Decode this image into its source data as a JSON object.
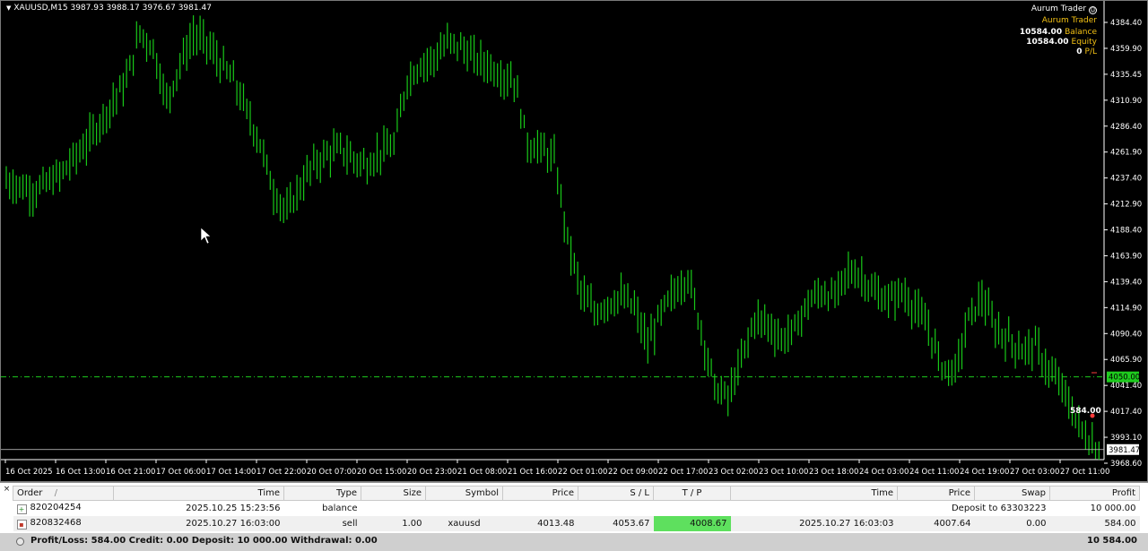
{
  "chart": {
    "symbol_header": "XAUUSD,M15  3987.93 3988.17 3976.67 3981.47",
    "ea": {
      "name": "Aurum Trader",
      "label": "Aurum Trader"
    },
    "account": {
      "balance_value": "10584.00",
      "balance_label": "Balance",
      "equity_value": "10584.00",
      "equity_label": "Equity",
      "pl_value": "0",
      "pl_label": "P/L"
    },
    "price_levels": [
      "4384.40",
      "4359.90",
      "4335.45",
      "4310.90",
      "4286.40",
      "4261.90",
      "4237.40",
      "4212.90",
      "4188.40",
      "4163.90",
      "4139.40",
      "4114.90",
      "4090.40",
      "4065.90",
      "4041.40",
      "4017.40",
      "3993.10",
      "3968.60"
    ],
    "time_labels": [
      "16 Oct 2025",
      "16 Oct 13:00",
      "16 Oct 21:00",
      "17 Oct 06:00",
      "17 Oct 14:00",
      "17 Oct 22:00",
      "20 Oct 07:00",
      "20 Oct 15:00",
      "20 Oct 23:00",
      "21 Oct 08:00",
      "21 Oct 16:00",
      "22 Oct 01:00",
      "22 Oct 09:00",
      "22 Oct 17:00",
      "23 Oct 02:00",
      "23 Oct 10:00",
      "23 Oct 18:00",
      "24 Oct 03:00",
      "24 Oct 11:00",
      "24 Oct 19:00",
      "27 Oct 03:00",
      "27 Oct 11:00"
    ],
    "level_tag": "4050.00",
    "current_price_tag": "3981.47",
    "pl_marker": "584.00",
    "colors": {
      "candles": "#18c818",
      "level_line": "#1ecb1e",
      "background": "#000000",
      "tag": "#1ecb1e",
      "text": "#ffffff"
    }
  },
  "chart_data": {
    "type": "line",
    "title": "XAUUSD,M15",
    "ylim": [
      3962,
      4396
    ],
    "x": [
      "16 Oct 2025",
      "16 Oct 13:00",
      "16 Oct 21:00",
      "17 Oct 06:00",
      "17 Oct 14:00",
      "17 Oct 22:00",
      "20 Oct 07:00",
      "20 Oct 15:00",
      "20 Oct 23:00",
      "21 Oct 08:00",
      "21 Oct 16:00",
      "22 Oct 01:00",
      "22 Oct 09:00",
      "22 Oct 17:00",
      "23 Oct 02:00",
      "23 Oct 10:00",
      "23 Oct 18:00",
      "24 Oct 03:00",
      "24 Oct 11:00",
      "24 Oct 19:00",
      "27 Oct 03:00",
      "27 Oct 11:00"
    ],
    "series": [
      {
        "values": [
          4235,
          4265,
          4375,
          4370,
          4230,
          4250,
          4265,
          4345,
          4365,
          4335,
          4115,
          4125,
          4120,
          4085,
          4110,
          4125,
          4145,
          4130,
          4065,
          4120,
          4085,
          4005
        ]
      }
    ],
    "level_line": 4050.0,
    "last_price": 3981.47,
    "close_points": [
      4235,
      4230,
      4225,
      4232,
      4240,
      4255,
      4270,
      4290,
      4310,
      4330,
      4375,
      4360,
      4310,
      4345,
      4372,
      4365,
      4345,
      4330,
      4300,
      4270,
      4225,
      4205,
      4230,
      4250,
      4260,
      4265,
      4255,
      4250,
      4262,
      4268,
      4330,
      4345,
      4350,
      4365,
      4362,
      4350,
      4345,
      4335,
      4330,
      4270,
      4265,
      4255,
      4180,
      4130,
      4110,
      4120,
      4125,
      4115,
      4080,
      4110,
      4130,
      4145,
      4095,
      4040,
      4030,
      4065,
      4105,
      4100,
      4085,
      4095,
      4120,
      4130,
      4125,
      4150,
      4145,
      4128,
      4122,
      4130,
      4115,
      4095,
      4060,
      4055,
      4105,
      4125,
      4095,
      4085,
      4075,
      4080,
      4055,
      4040,
      4010,
      3990,
      3980
    ]
  },
  "terminal": {
    "columns": [
      "Order",
      "Time",
      "Type",
      "Size",
      "Symbol",
      "Price",
      "S / L",
      "T / P",
      "Time",
      "Price",
      "Swap",
      "Profit"
    ],
    "sort_glyph": "/",
    "close_glyph": "×",
    "rows": [
      {
        "order": "820204254",
        "time": "2025.10.25 15:23:56",
        "type": "balance",
        "comment": "Deposit to 63303223",
        "profit": "10 000.00"
      },
      {
        "order": "820832468",
        "time": "2025.10.27 16:03:00",
        "type": "sell",
        "size": "1.00",
        "symbol": "xauusd",
        "price": "4013.48",
        "sl": "4053.67",
        "tp": "4008.67",
        "close_time": "2025.10.27 16:03:03",
        "close_price": "4007.64",
        "swap": "0.00",
        "profit": "584.00"
      }
    ],
    "summary": "Profit/Loss: 584.00  Credit: 0.00  Deposit: 10 000.00  Withdrawal: 0.00",
    "total": "10 584.00"
  }
}
